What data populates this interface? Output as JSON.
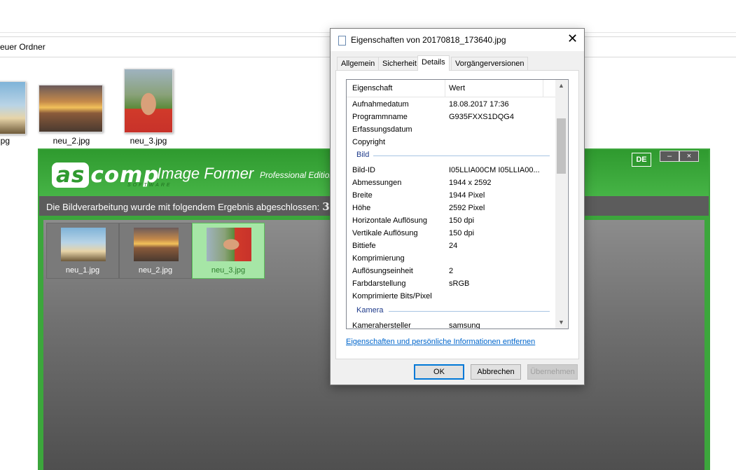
{
  "explorer": {
    "path_label": "euer Ordner",
    "files": [
      {
        "name": "jpg"
      },
      {
        "name": "neu_2.jpg"
      },
      {
        "name": "neu_3.jpg"
      }
    ]
  },
  "ascomp": {
    "logo_text": "ascomp",
    "logo_prefix": "as",
    "logo_rest": "comp",
    "software_text": "SOFTWARE",
    "app_title": "Image Former",
    "edition": "Professional Edition",
    "lang_badge": "DE",
    "minimize_label": "–",
    "close_label": "×",
    "status_text": "Die Bildverarbeitung wurde mit folgendem Ergebnis abgeschlossen:",
    "status_count": "3",
    "items": [
      {
        "caption": "neu_1.jpg",
        "selected": false
      },
      {
        "caption": "neu_2.jpg",
        "selected": false
      },
      {
        "caption": "neu_3.jpg",
        "selected": true
      }
    ]
  },
  "dialog": {
    "title": "Eigenschaften von 20170818_173640.jpg",
    "close_label": "✕",
    "tabs": [
      {
        "label": "Allgemein",
        "active": false
      },
      {
        "label": "Sicherheit",
        "active": false
      },
      {
        "label": "Details",
        "active": true
      },
      {
        "label": "Vorgängerversionen",
        "active": false
      }
    ],
    "columns": {
      "property": "Eigenschaft",
      "value": "Wert"
    },
    "rows_top": [
      {
        "key": "Aufnahmedatum",
        "value": "18.08.2017 17:36"
      },
      {
        "key": "Programmname",
        "value": "G935FXXS1DQG4"
      },
      {
        "key": "Erfassungsdatum",
        "value": ""
      },
      {
        "key": "Copyright",
        "value": ""
      }
    ],
    "group_bild": "Bild",
    "rows_bild": [
      {
        "key": "Bild-ID",
        "value": "I05LLIA00CM I05LLIA00..."
      },
      {
        "key": "Abmessungen",
        "value": "1944 x 2592"
      },
      {
        "key": "Breite",
        "value": "1944 Pixel"
      },
      {
        "key": "Höhe",
        "value": "2592 Pixel"
      },
      {
        "key": "Horizontale Auflösung",
        "value": "150 dpi"
      },
      {
        "key": "Vertikale Auflösung",
        "value": "150 dpi"
      },
      {
        "key": "Bittiefe",
        "value": "24"
      },
      {
        "key": "Komprimierung",
        "value": ""
      },
      {
        "key": "Auflösungseinheit",
        "value": "2"
      },
      {
        "key": "Farbdarstellung",
        "value": "sRGB"
      },
      {
        "key": "Komprimierte Bits/Pixel",
        "value": ""
      }
    ],
    "group_kamera": "Kamera",
    "rows_kamera": [
      {
        "key": "Kamerahersteller",
        "value": "samsung"
      }
    ],
    "remove_link": "Eigenschaften und persönliche Informationen entfernen",
    "buttons": {
      "ok": "OK",
      "cancel": "Abbrechen",
      "apply": "Übernehmen"
    }
  }
}
